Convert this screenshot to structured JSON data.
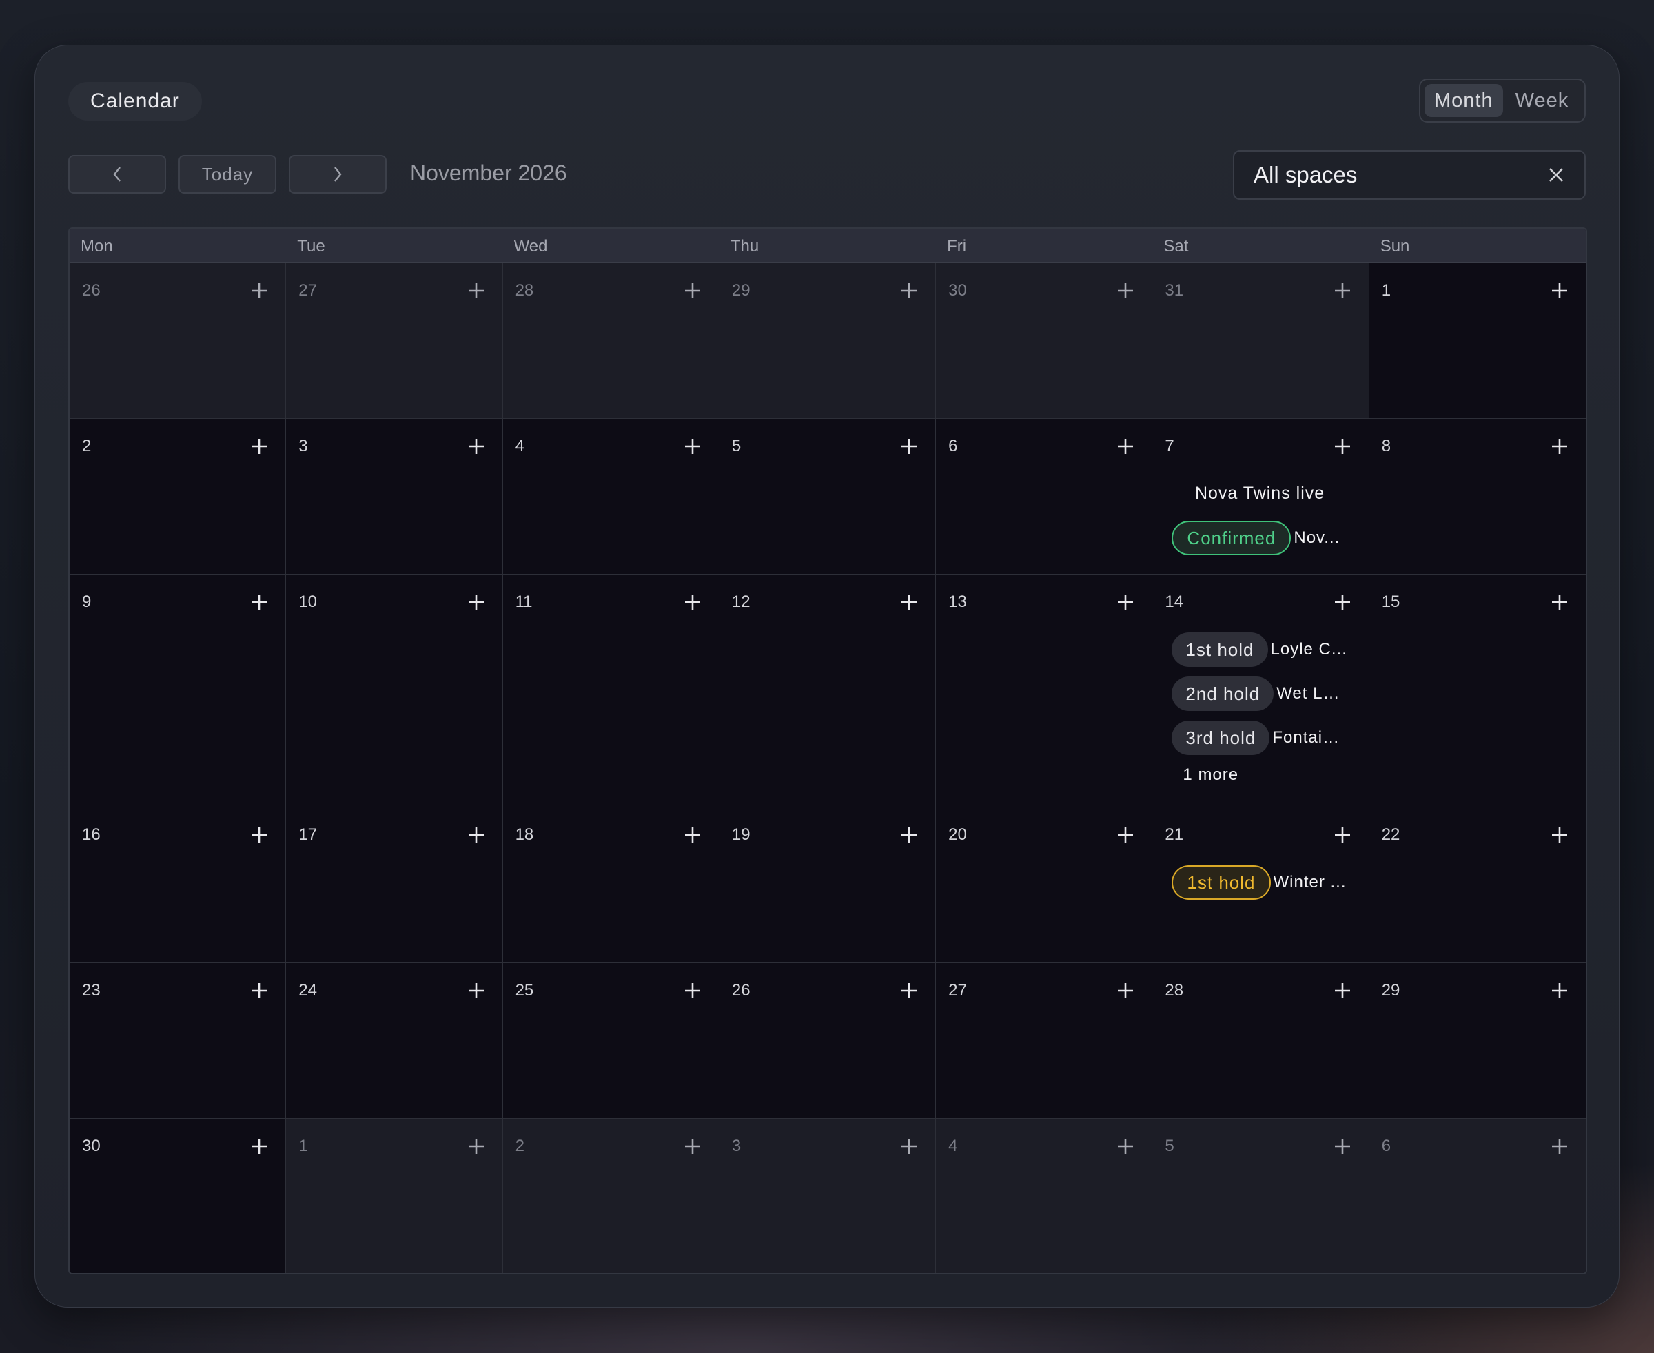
{
  "app": {
    "title": "Calendar"
  },
  "view_toggle": {
    "month": "Month",
    "week": "Week",
    "active": "Month"
  },
  "nav": {
    "today": "Today",
    "month_label": "November 2026"
  },
  "filter": {
    "value": "All spaces"
  },
  "colors": {
    "confirmed": "#3fc27a",
    "hold_yellow": "#f0b92f",
    "bg": "#0d0c15"
  },
  "weekdays": [
    "Mon",
    "Tue",
    "Wed",
    "Thu",
    "Fri",
    "Sat",
    "Sun"
  ],
  "weeks": [
    {
      "days": [
        {
          "num": "26",
          "out": true
        },
        {
          "num": "27",
          "out": true
        },
        {
          "num": "28",
          "out": true
        },
        {
          "num": "29",
          "out": true
        },
        {
          "num": "30",
          "out": true
        },
        {
          "num": "31",
          "out": true
        },
        {
          "num": "1",
          "out": false
        }
      ]
    },
    {
      "days": [
        {
          "num": "2"
        },
        {
          "num": "3"
        },
        {
          "num": "4"
        },
        {
          "num": "5"
        },
        {
          "num": "6"
        },
        {
          "num": "7",
          "events": [
            {
              "plain": "Nova Twins live"
            },
            {
              "badge": "Confirmed",
              "style": "confirmed",
              "title": "Nov..."
            }
          ]
        },
        {
          "num": "8"
        }
      ]
    },
    {
      "days": [
        {
          "num": "9"
        },
        {
          "num": "10"
        },
        {
          "num": "11"
        },
        {
          "num": "12"
        },
        {
          "num": "13"
        },
        {
          "num": "14",
          "events": [
            {
              "badge": "1st hold",
              "style": "plain",
              "title": "Loyle C..."
            },
            {
              "badge": "2nd hold",
              "style": "plain",
              "title": "Wet Le..."
            },
            {
              "badge": "3rd hold",
              "style": "plain",
              "title": "Fontain..."
            }
          ],
          "more": "1 more"
        },
        {
          "num": "15"
        }
      ]
    },
    {
      "days": [
        {
          "num": "16"
        },
        {
          "num": "17"
        },
        {
          "num": "18"
        },
        {
          "num": "19"
        },
        {
          "num": "20"
        },
        {
          "num": "21",
          "events": [
            {
              "badge": "1st hold",
              "style": "hold-yellow",
              "title": "Winter ..."
            }
          ]
        },
        {
          "num": "22"
        }
      ]
    },
    {
      "days": [
        {
          "num": "23"
        },
        {
          "num": "24"
        },
        {
          "num": "25"
        },
        {
          "num": "26"
        },
        {
          "num": "27"
        },
        {
          "num": "28"
        },
        {
          "num": "29"
        }
      ]
    },
    {
      "days": [
        {
          "num": "30"
        },
        {
          "num": "1",
          "out": true
        },
        {
          "num": "2",
          "out": true
        },
        {
          "num": "3",
          "out": true
        },
        {
          "num": "4",
          "out": true
        },
        {
          "num": "5",
          "out": true
        },
        {
          "num": "6",
          "out": true
        }
      ]
    }
  ]
}
